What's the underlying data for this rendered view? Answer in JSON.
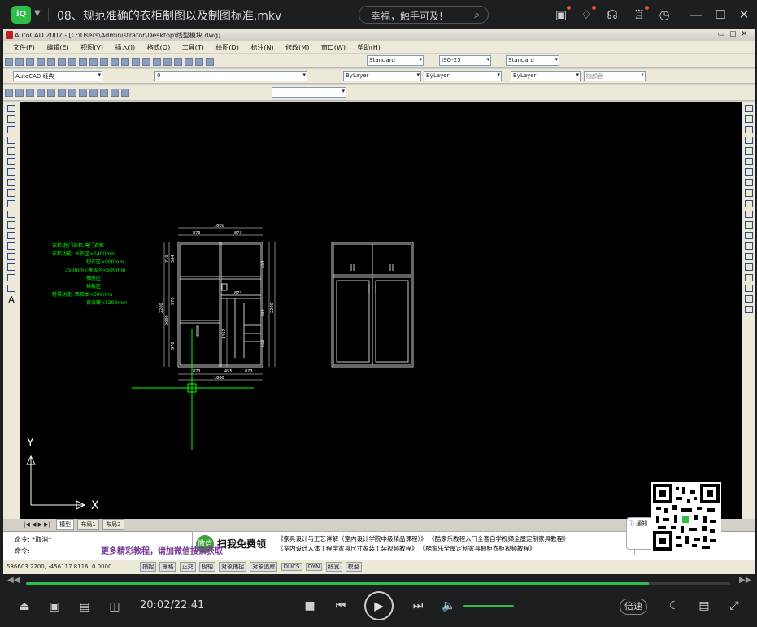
{
  "titlebar": {
    "logo_text": "iQ",
    "title": "08、规范准确的衣柜制图以及制图标准.mkv",
    "search_placeholder": "幸福，触手可及!"
  },
  "acad": {
    "window_title": "AutoCAD 2007 - [C:\\Users\\Administrator\\Desktop\\线型模块.dwg]",
    "menu": [
      "文件(F)",
      "编辑(E)",
      "视图(V)",
      "插入(I)",
      "格式(O)",
      "工具(T)",
      "绘图(D)",
      "标注(N)",
      "修改(M)",
      "窗口(W)",
      "帮助(H)"
    ],
    "text_style": "Standard",
    "dim_style": "ISO-25",
    "table_style": "Standard",
    "workspace": "AutoCAD 经典",
    "layer": "0",
    "color": "ByLayer",
    "linetype": "ByLayer",
    "lineweight": "ByLayer",
    "plotstyle": "随颜色",
    "tabs": [
      "模型",
      "布局1",
      "布局2"
    ],
    "cmd_line1": "命令: *取消*",
    "cmd_line2": "命令:",
    "coords": "536603.2200, -456117.8116, 0.0000",
    "status_buttons": [
      "捕捉",
      "栅格",
      "正交",
      "极轴",
      "对象捕捉",
      "对象追踪",
      "DUCS",
      "DYN",
      "线宽",
      "模型"
    ],
    "axis_x": "X",
    "axis_y": "Y"
  },
  "drawing": {
    "notes": [
      "衣柜:趟门衣柜,掩门衣柜",
      "衣柜功能: 长衣区>1400mm",
      "短衣区>900mm",
      "350mm<叠放区<500mm",
      "抽屉区",
      "格板区",
      "特殊功能: 西裤抽<500mm",
      "背衣镜<1200mm"
    ],
    "dims": {
      "total_width": "1800",
      "top_left": "873",
      "top_right": "873",
      "bottom_left": "873",
      "bottom_mid": "455",
      "bottom_right": "873",
      "bottom_total": "1800",
      "mid_873": "873",
      "left_710": "710",
      "left_564": "564",
      "left_978": "978",
      "left_2200": "2200",
      "left_2090": "2090",
      "left_978b": "978",
      "right_564": "564",
      "right_1467": "1467",
      "right_480": "480",
      "right_560": "560",
      "right_2200": "2200"
    }
  },
  "ad": {
    "wechat": "微信",
    "free_text": "扫我免费领",
    "line1": "《家具设计与工艺详解（室内设计学院中级精品课程）》 《酷家乐教程入门全套自学视频全屋定制家具教程》",
    "line2": "《室内设计人体工程学家具尺寸家装工装视频教程》 《酷家乐全屋定制家具橱柜衣柜视频教程》",
    "sub": "更多精彩教程，请加微信搜索获取",
    "qr_note": "通知"
  },
  "player": {
    "time": "20:02/22:41",
    "progress": 0.885,
    "volume": 0.85,
    "speed_label": "倍速"
  },
  "colors": {
    "accent": "#2fbd4a",
    "cad_bg": "#000000",
    "cad_green": "#00ff00",
    "cad_white": "#ffffff"
  }
}
